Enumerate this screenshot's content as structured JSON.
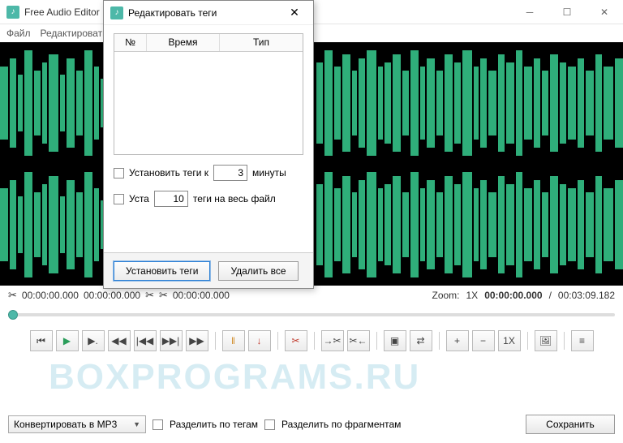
{
  "window": {
    "title": "Free Audio Editor"
  },
  "menu": {
    "file": "Файл",
    "edit": "Редактировать"
  },
  "timeline": {
    "t1": "00:00:00.000",
    "t2": "00:00:00.000",
    "t3": "00:00:00.000",
    "zoom_label": "Zoom:",
    "zoom_value": "1X",
    "pos": "00:00:00.000",
    "dur_sep": "/",
    "dur": "00:03:09.182"
  },
  "bottom": {
    "convert_label": "Конвертировать в MP3",
    "split_tags": "Разделить по тегам",
    "split_frag": "Разделить по фрагментам",
    "save": "Сохранить"
  },
  "toolbar": {
    "zoom_1x": "1X"
  },
  "dialog": {
    "title": "Редактировать теги",
    "cols": {
      "num": "№",
      "time": "Время",
      "type": "Тип"
    },
    "row1": {
      "label": "Установить теги к",
      "value": "3",
      "unit": "минуты"
    },
    "row2": {
      "label": "Уста",
      "value": "10",
      "suffix": "теги на весь файл"
    },
    "set_btn": "Установить теги",
    "del_btn": "Удалить все"
  },
  "watermark": "BOXPROGRAMS.RU"
}
